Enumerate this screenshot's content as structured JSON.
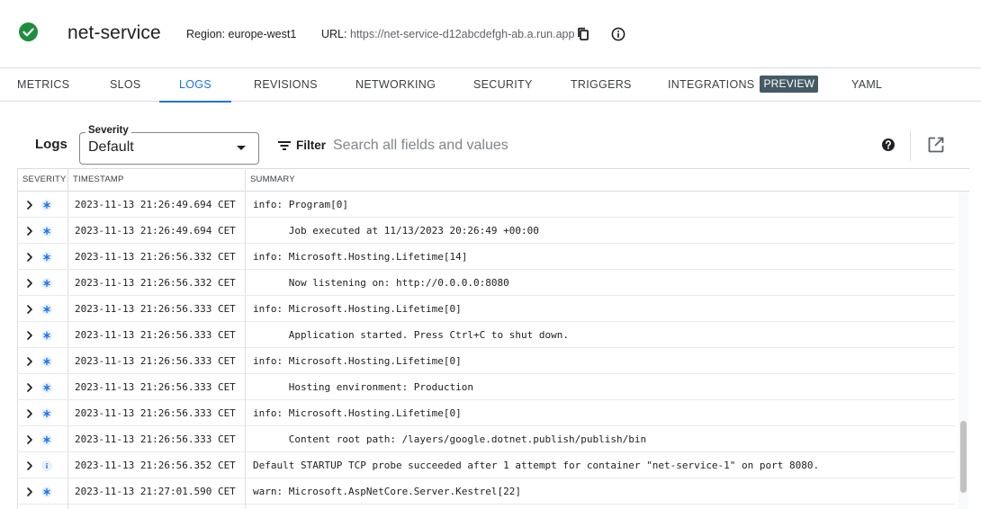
{
  "header": {
    "service_name": "net-service",
    "region": "Region: europe-west1",
    "url_label": "URL:",
    "url_value": "https://net-service-d12abcdefgh-ab.a.run.app",
    "status_icon": "check-circle-icon",
    "status_color": "#1e8e3e"
  },
  "tabs": [
    {
      "label": "METRICS"
    },
    {
      "label": "SLOS"
    },
    {
      "label": "LOGS",
      "active": true
    },
    {
      "label": "REVISIONS"
    },
    {
      "label": "NETWORKING"
    },
    {
      "label": "SECURITY"
    },
    {
      "label": "TRIGGERS"
    },
    {
      "label": "INTEGRATIONS",
      "badge": "PREVIEW"
    },
    {
      "label": "YAML"
    }
  ],
  "logs": {
    "title": "Logs",
    "severity_label": "Severity",
    "severity_value": "Default",
    "filter_label": "Filter",
    "search_placeholder": "Search all fields and values"
  },
  "table": {
    "columns": [
      "SEVERITY",
      "TIMESTAMP",
      "SUMMARY"
    ],
    "rows": [
      {
        "severity": "default",
        "timestamp": "2023-11-13 21:26:49.694 CET",
        "summary": "info: Program[0]"
      },
      {
        "severity": "default",
        "timestamp": "2023-11-13 21:26:49.694 CET",
        "summary": "      Job executed at 11/13/2023 20:26:49 +00:00"
      },
      {
        "severity": "default",
        "timestamp": "2023-11-13 21:26:56.332 CET",
        "summary": "info: Microsoft.Hosting.Lifetime[14]"
      },
      {
        "severity": "default",
        "timestamp": "2023-11-13 21:26:56.332 CET",
        "summary": "      Now listening on: http://0.0.0.0:8080"
      },
      {
        "severity": "default",
        "timestamp": "2023-11-13 21:26:56.333 CET",
        "summary": "info: Microsoft.Hosting.Lifetime[0]"
      },
      {
        "severity": "default",
        "timestamp": "2023-11-13 21:26:56.333 CET",
        "summary": "      Application started. Press Ctrl+C to shut down."
      },
      {
        "severity": "default",
        "timestamp": "2023-11-13 21:26:56.333 CET",
        "summary": "info: Microsoft.Hosting.Lifetime[0]"
      },
      {
        "severity": "default",
        "timestamp": "2023-11-13 21:26:56.333 CET",
        "summary": "      Hosting environment: Production"
      },
      {
        "severity": "default",
        "timestamp": "2023-11-13 21:26:56.333 CET",
        "summary": "info: Microsoft.Hosting.Lifetime[0]"
      },
      {
        "severity": "default",
        "timestamp": "2023-11-13 21:26:56.333 CET",
        "summary": "      Content root path: /layers/google.dotnet.publish/publish/bin"
      },
      {
        "severity": "info",
        "timestamp": "2023-11-13 21:26:56.352 CET",
        "summary": "Default STARTUP TCP probe succeeded after 1 attempt for container \"net-service-1\" on port 8080."
      },
      {
        "severity": "default",
        "timestamp": "2023-11-13 21:27:01.590 CET",
        "summary": "warn: Microsoft.AspNetCore.Server.Kestrel[22]"
      }
    ]
  },
  "colors": {
    "accent": "#1a73e8",
    "badge_bg": "#455a64",
    "severity_icon": "#1a73e8"
  }
}
